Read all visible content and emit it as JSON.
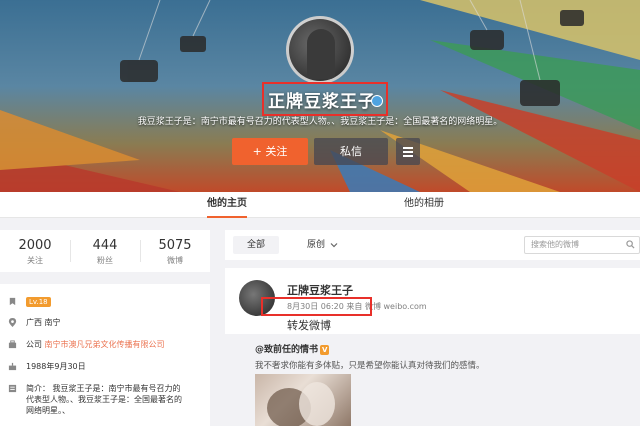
{
  "profile": {
    "name": "正牌豆浆王子",
    "bio": "我豆浆王子是：南宁市最有号召力的代表型人物。、我豆浆王子是：全国最著名的网络明星。",
    "follow_label": "+ 关注",
    "message_label": "私信"
  },
  "tabs": [
    {
      "label": "他的主页",
      "active": true
    },
    {
      "label": "他的相册",
      "active": false
    }
  ],
  "stats": [
    {
      "value": "2000",
      "label": "关注"
    },
    {
      "value": "444",
      "label": "粉丝"
    },
    {
      "value": "5075",
      "label": "微博"
    }
  ],
  "info": {
    "level": "Lv.18",
    "location": "广西 南宁",
    "company_prefix": "公司",
    "company": "南宁市澳凡兄弟文化传播有限公司",
    "birthday": "1988年9月30日",
    "intro_line1": "简介： 我豆浆王子是：南宁市最有号召力的",
    "intro_line2": "代表型人物。、我豆浆王子是：全国最著名的",
    "intro_line3": "网络明星。、"
  },
  "feed_filter": {
    "all_label": "全部",
    "original_label": "原创",
    "search_placeholder": "搜索他的微博"
  },
  "post": {
    "author": "正牌豆浆王子",
    "time": "8月30日 06:20 来自",
    "source": "微博 weibo.com",
    "text": "转发微博",
    "repost_author": "@致前任的情书",
    "repost_badge": "V",
    "repost_text": "我不奢求你能有多体贴，只是希望你能认真对待我们的感情。"
  },
  "colors": {
    "accent": "#f0622e",
    "highlight_box": "#e8302a",
    "link": "#eb7350",
    "verified": "#4ea3e0"
  },
  "icons": [
    "verified-icon",
    "menu-icon",
    "level-icon",
    "location-icon",
    "company-icon",
    "birthday-icon",
    "intro-icon",
    "search-icon",
    "chevron-down-icon"
  ]
}
